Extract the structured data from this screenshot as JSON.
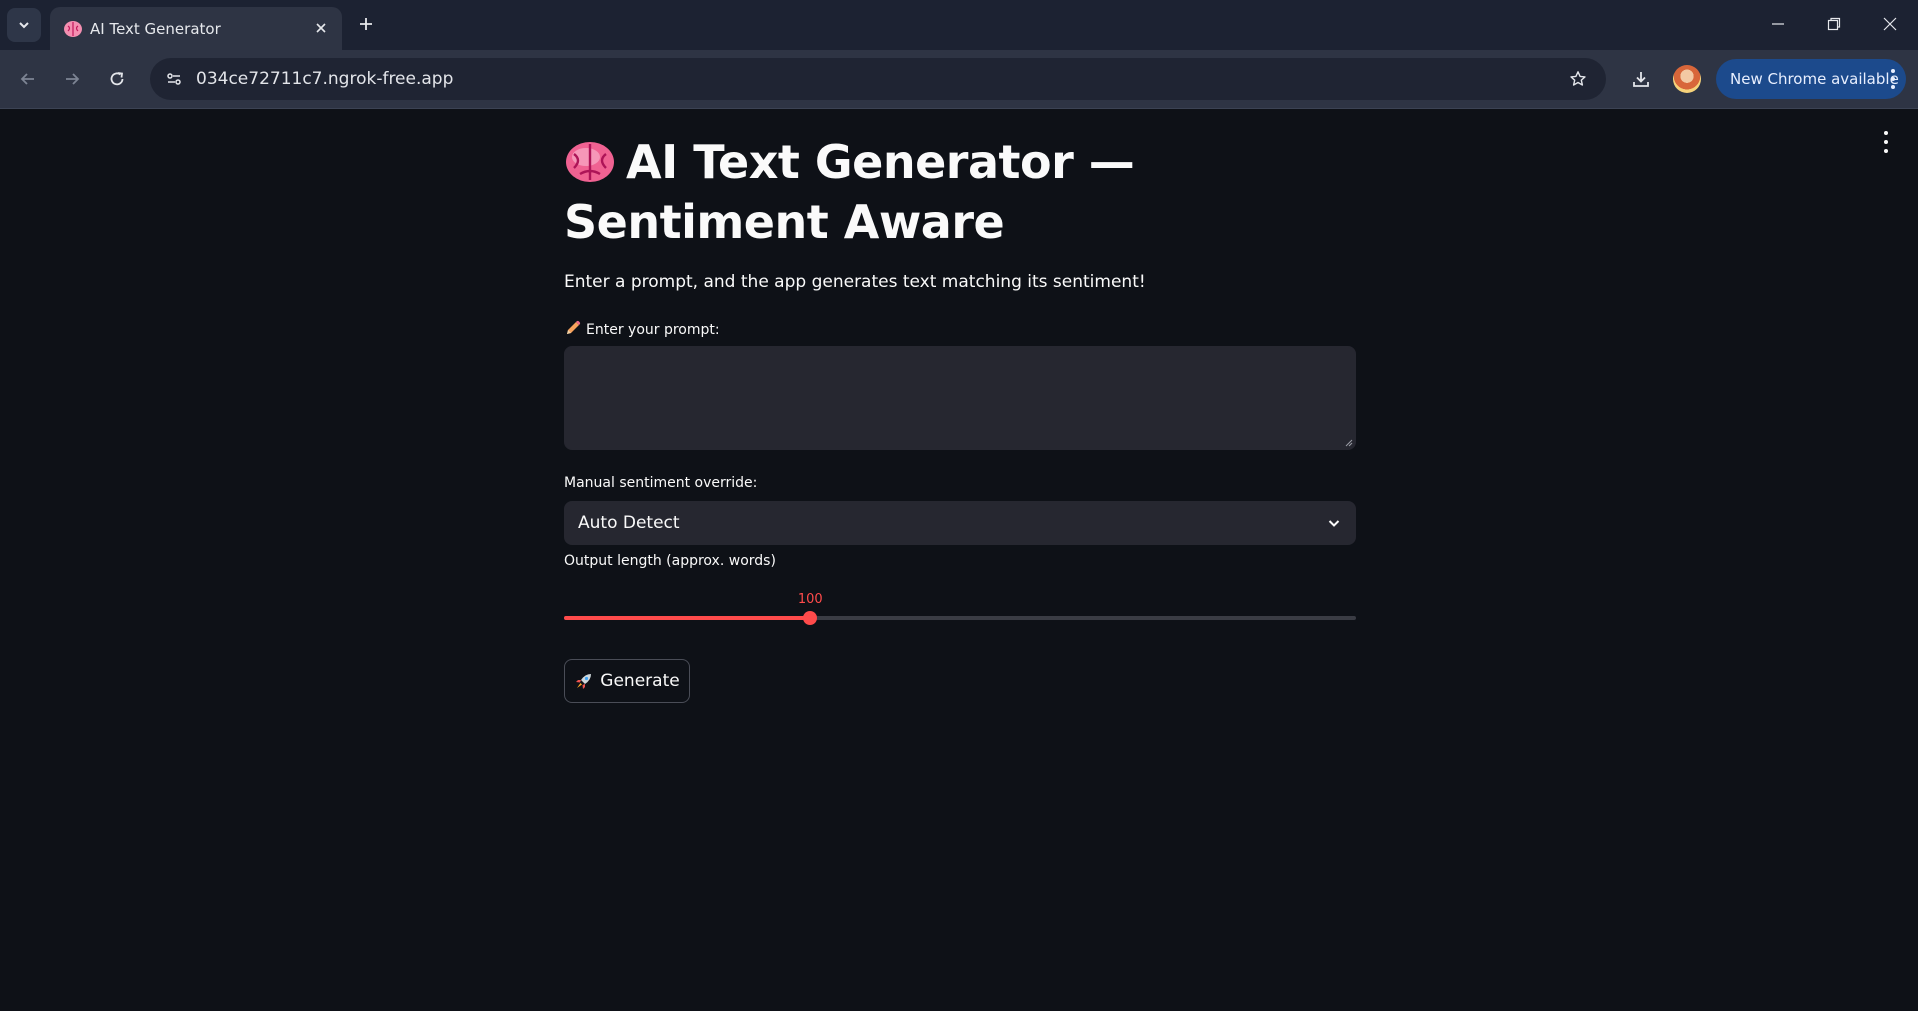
{
  "browser": {
    "tab_title": "AI Text Generator",
    "url": "034ce72711c7.ngrok-free.app",
    "update_button_label": "New Chrome available",
    "icons": [
      "tab-search-icon",
      "brain-icon",
      "close-icon",
      "plus-icon",
      "minimize-icon",
      "restore-icon",
      "window-close-icon",
      "back-arrow-icon",
      "forward-arrow-icon",
      "reload-icon",
      "site-info-icon",
      "star-icon",
      "download-icon",
      "more-vert-icon"
    ]
  },
  "app": {
    "title": "AI Text Generator — Sentiment Aware",
    "subtitle": "Enter a prompt, and the app generates text matching its sentiment!",
    "prompt_label": "Enter your prompt:",
    "prompt_value": "",
    "sentiment_label": "Manual sentiment override:",
    "sentiment_selected": "Auto Detect",
    "length_label": "Output length (approx. words)",
    "length_value": "100",
    "length_fraction": 0.311,
    "generate_label": "Generate",
    "accent_color": "#ff4b4b",
    "background_color": "#0e1117"
  }
}
